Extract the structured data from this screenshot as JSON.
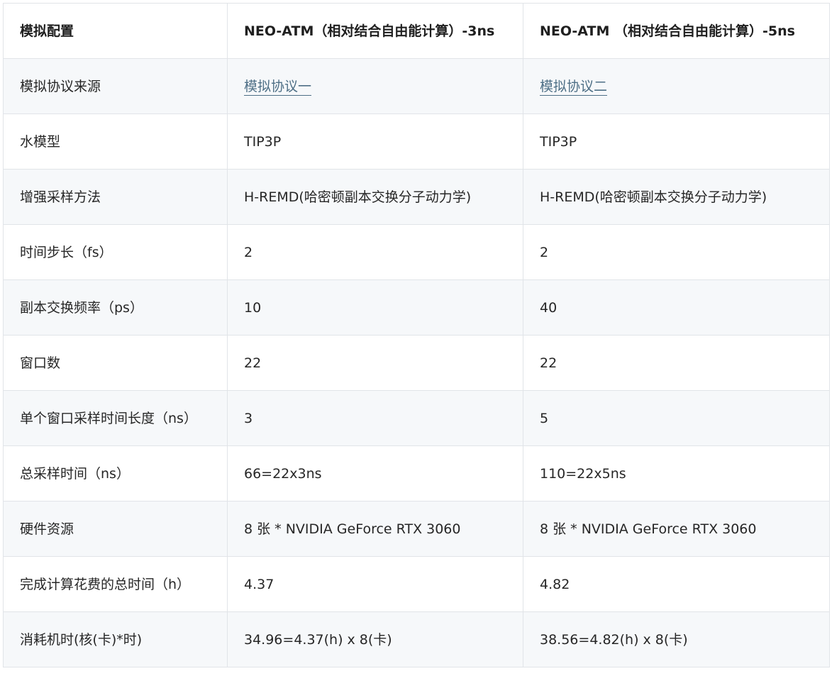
{
  "header": {
    "col1": "模拟配置",
    "col2": "NEO-ATM（相对结合自由能计算）-3ns",
    "col3": "NEO-ATM （相对结合自由能计算）-5ns"
  },
  "rows": [
    {
      "label": "模拟协议来源",
      "v1": "模拟协议一",
      "v2": "模拟协议二"
    },
    {
      "label": "水模型",
      "v1": "TIP3P",
      "v2": "TIP3P"
    },
    {
      "label": "增强采样方法",
      "v1": "H-REMD(哈密顿副本交换分子动力学)",
      "v2": "H-REMD(哈密顿副本交换分子动力学)"
    },
    {
      "label": "时间步长（fs）",
      "v1": "2",
      "v2": "2"
    },
    {
      "label": "副本交换频率（ps）",
      "v1": "10",
      "v2": "40"
    },
    {
      "label": "窗口数",
      "v1": "22",
      "v2": "22"
    },
    {
      "label": "单个窗口采样时间长度（ns）",
      "v1": "3",
      "v2": "5"
    },
    {
      "label": "总采样时间（ns）",
      "v1": "66=22x3ns",
      "v2": "110=22x5ns"
    },
    {
      "label": "硬件资源",
      "v1": "8 张 * NVIDIA GeForce RTX 3060",
      "v2": "8 张 * NVIDIA GeForce RTX 3060"
    },
    {
      "label": "完成计算花费的总时间（h）",
      "v1": "4.37",
      "v2": "4.82"
    },
    {
      "label": "消耗机时(核(卡)*时)",
      "v1": "34.96=4.37(h) x 8(卡)",
      "v2": "38.56=4.82(h) x 8(卡)"
    }
  ],
  "colors": {
    "border": "#e1e4e8",
    "stripe": "#f6f8fa",
    "link": "#4e6f86",
    "text": "#262626"
  }
}
